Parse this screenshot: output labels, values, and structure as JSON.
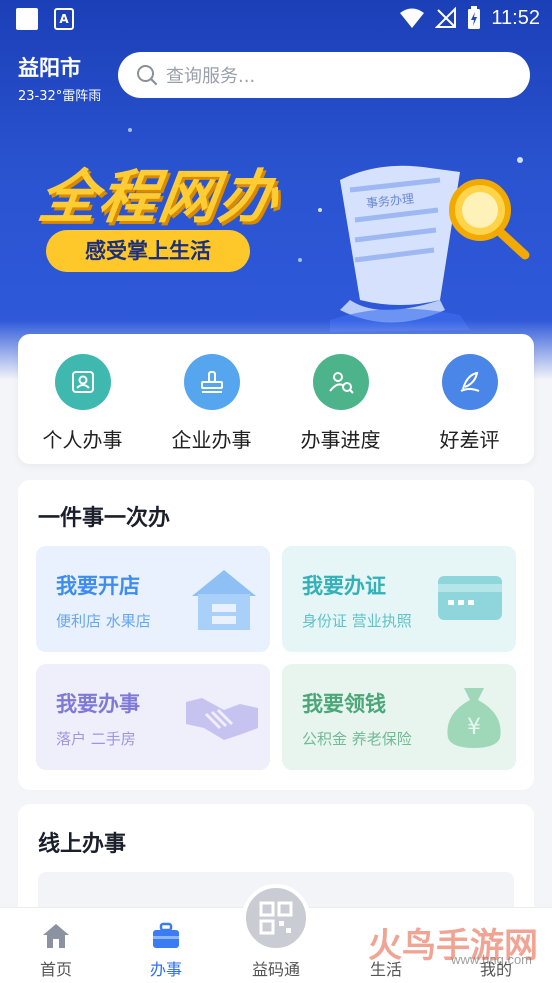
{
  "status_bar": {
    "time": "11:52",
    "app_glyph": "A"
  },
  "header": {
    "city": "益阳市",
    "weather": "23-32°雷阵雨",
    "search_placeholder": "查询服务..."
  },
  "banner": {
    "title": "全程网办",
    "subtitle": "感受掌上生活",
    "paper_text": "事务办理"
  },
  "quick_actions": [
    {
      "label": "个人办事",
      "color": "#3fb8b0",
      "icon": "id-card-icon"
    },
    {
      "label": "企业办事",
      "color": "#56a6ef",
      "icon": "stamp-icon"
    },
    {
      "label": "办事进度",
      "color": "#4db38a",
      "icon": "progress-search-icon"
    },
    {
      "label": "好差评",
      "color": "#4a86e8",
      "icon": "pen-icon"
    }
  ],
  "one_thing": {
    "title": "一件事一次办",
    "tiles": [
      {
        "title": "我要开店",
        "sub": "便利店 水果店",
        "color": "#3d8df0",
        "bg": "#e8f1fd"
      },
      {
        "title": "我要办证",
        "sub": "身份证 营业执照",
        "color": "#33b1b8",
        "bg": "#e6f6f7"
      },
      {
        "title": "我要办事",
        "sub": "落户 二手房",
        "color": "#7f7ad8",
        "bg": "#efeefb"
      },
      {
        "title": "我要领钱",
        "sub": "公积金 养老保险",
        "color": "#4ba779",
        "bg": "#e7f5ee"
      }
    ]
  },
  "online": {
    "title": "线上办事"
  },
  "tabs": [
    {
      "label": "首页",
      "active": false
    },
    {
      "label": "办事",
      "active": true
    },
    {
      "label": "益码通",
      "active": false
    },
    {
      "label": "生活",
      "active": false
    },
    {
      "label": "我的",
      "active": false
    }
  ],
  "watermark": {
    "brand": "火鸟手游网",
    "url": "www.hnq.com"
  }
}
